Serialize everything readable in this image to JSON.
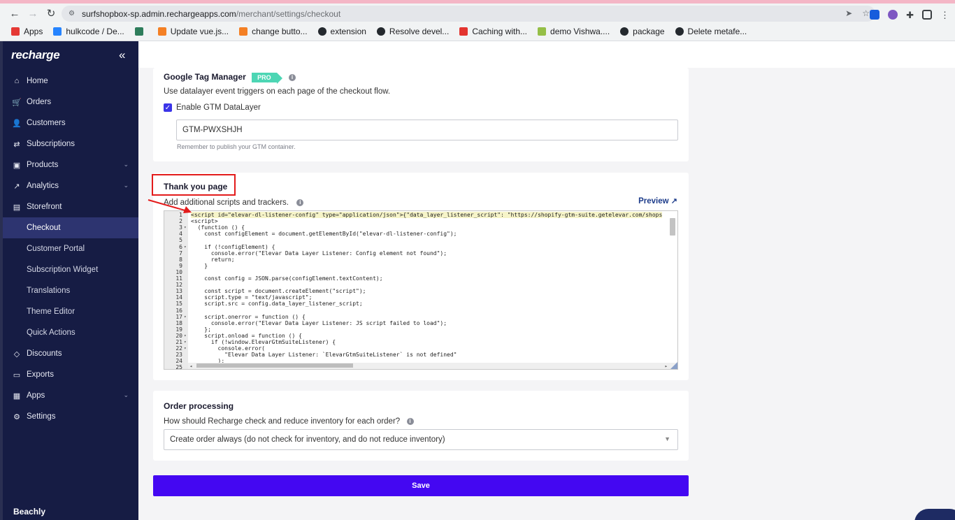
{
  "browser": {
    "url_host": "surfshopbox-sp.admin.rechargeapps.com",
    "url_path": "/merchant/settings/checkout",
    "bookmarks": [
      {
        "label": "Apps",
        "icon": "apps-grid-icon",
        "color": "#e53935"
      },
      {
        "label": "hulkcode / De...",
        "icon": "bitbucket-icon",
        "color": "#2684ff"
      },
      {
        "label": "",
        "icon": "vue-icon",
        "color": "#2e7d5b"
      },
      {
        "label": "Update vue.js...",
        "icon": "stackoverflow-icon",
        "color": "#f48024"
      },
      {
        "label": "change butto...",
        "icon": "stackoverflow-icon",
        "color": "#f48024"
      },
      {
        "label": "extension",
        "icon": "github-icon",
        "color": "#24292e"
      },
      {
        "label": "Resolve devel...",
        "icon": "github-icon",
        "color": "#24292e"
      },
      {
        "label": "Caching with...",
        "icon": "laravel-icon",
        "color": "#e3342f"
      },
      {
        "label": "demo Vishwa....",
        "icon": "shopify-icon",
        "color": "#95bf47"
      },
      {
        "label": "package",
        "icon": "github-icon",
        "color": "#24292e"
      },
      {
        "label": "Delete metafe...",
        "icon": "github-icon",
        "color": "#24292e"
      }
    ]
  },
  "sidebar": {
    "brand": "recharge",
    "collapse_icon": "«",
    "items": [
      {
        "label": "Home",
        "icon": "home-icon",
        "glyph": "⌂"
      },
      {
        "label": "Orders",
        "icon": "cart-icon",
        "glyph": "🛒"
      },
      {
        "label": "Customers",
        "icon": "user-icon",
        "glyph": "👤"
      },
      {
        "label": "Subscriptions",
        "icon": "repeat-icon",
        "glyph": "⇄"
      },
      {
        "label": "Products",
        "icon": "box-icon",
        "glyph": "▣",
        "expandable": true
      },
      {
        "label": "Analytics",
        "icon": "chart-line-icon",
        "glyph": "↗",
        "expandable": true
      },
      {
        "label": "Storefront",
        "icon": "storefront-icon",
        "glyph": "▤"
      }
    ],
    "storefront_sub": [
      {
        "label": "Checkout",
        "active": true
      },
      {
        "label": "Customer Portal"
      },
      {
        "label": "Subscription Widget"
      },
      {
        "label": "Translations"
      },
      {
        "label": "Theme Editor"
      },
      {
        "label": "Quick Actions"
      }
    ],
    "items_after": [
      {
        "label": "Discounts",
        "icon": "tag-icon",
        "glyph": "◇"
      },
      {
        "label": "Exports",
        "icon": "folder-icon",
        "glyph": "▭"
      },
      {
        "label": "Apps",
        "icon": "apps-icon",
        "glyph": "▦",
        "expandable": true
      },
      {
        "label": "Settings",
        "icon": "gear-icon",
        "glyph": "⚙"
      }
    ],
    "store_name": "Beachly"
  },
  "gtm": {
    "title": "Google Tag Manager",
    "badge": "PRO",
    "description": "Use datalayer event triggers on each page of the checkout flow.",
    "checkbox_label": "Enable GTM DataLayer",
    "container_id": "GTM-PWXSHJH",
    "helper": "Remember to publish your GTM container."
  },
  "thankyou": {
    "title": "Thank you page",
    "description": "Add additional scripts and trackers.",
    "preview_label": "Preview",
    "code_lines": [
      "<script id=\"elevar-dl-listener-config\" type=\"application/json\">{\"data_layer_listener_script\": \"https://shopify-gtm-suite.getelevar.com/shops",
      "<script>",
      "  (function () {",
      "    const configElement = document.getElementById(\"elevar-dl-listener-config\");",
      "",
      "    if (!configElement) {",
      "      console.error(\"Elevar Data Layer Listener: Config element not found\");",
      "      return;",
      "    }",
      "",
      "    const config = JSON.parse(configElement.textContent);",
      "",
      "    const script = document.createElement(\"script\");",
      "    script.type = \"text/javascript\";",
      "    script.src = config.data_layer_listener_script;",
      "",
      "    script.onerror = function () {",
      "      console.error(\"Elevar Data Layer Listener: JS script failed to load\");",
      "    };",
      "    script.onload = function () {",
      "      if (!window.ElevarGtmSuiteListener) {",
      "        console.error(",
      "          \"Elevar Data Layer Listener: `ElevarGtmSuiteListener` is not defined\"",
      "        );",
      ""
    ],
    "line_numbers": [
      "1",
      "2",
      "3",
      "4",
      "5",
      "6",
      "7",
      "8",
      "9",
      "10",
      "11",
      "12",
      "13",
      "14",
      "15",
      "16",
      "17",
      "18",
      "19",
      "20",
      "21",
      "22",
      "23",
      "24",
      "25"
    ]
  },
  "order_processing": {
    "title": "Order processing",
    "question": "How should Recharge check and reduce inventory for each order?",
    "selected": "Create order always (do not check for inventory, and do not reduce inventory)"
  },
  "save_label": "Save",
  "colors": {
    "sidebar_bg": "#161c44",
    "accent": "#4407f2",
    "pro_badge": "#4dd6b4",
    "highlight": "#e31b1b"
  }
}
